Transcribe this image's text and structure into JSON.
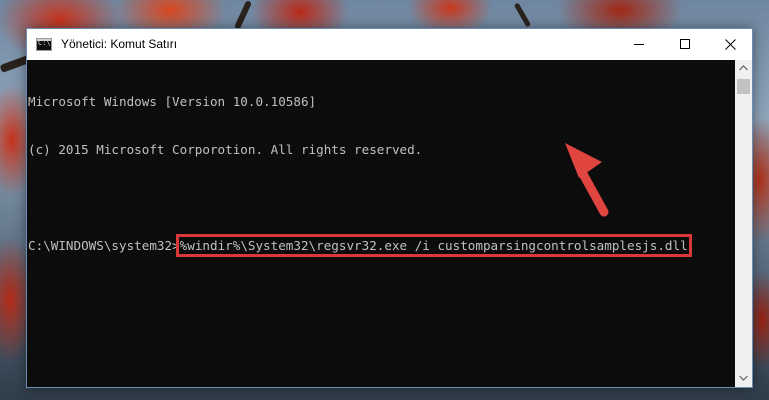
{
  "window": {
    "title": "Yönetici: Komut Satırı",
    "icon": "command-prompt-icon",
    "buttons": {
      "minimize": "minimize-icon",
      "maximize": "maximize-icon",
      "close": "close-icon"
    }
  },
  "console": {
    "lines": [
      "Microsoft Windows [Version 10.0.10586]",
      "(c) 2015 Microsoft Corporotion. All rights reserved."
    ],
    "prompt": "C:\\WINDOWS\\system32>",
    "command": "%windir%\\System32\\regsvr32.exe /i customparsingcontrolsamplesjs.dll"
  },
  "colors": {
    "console_background": "#0c0c0c",
    "console_text": "#c0c0c0",
    "highlight": "#d9373a",
    "arrow": "#e0453f"
  },
  "annotation": {
    "highlight_box": "command-highlight",
    "arrow_icon": "red-arrow-icon"
  }
}
